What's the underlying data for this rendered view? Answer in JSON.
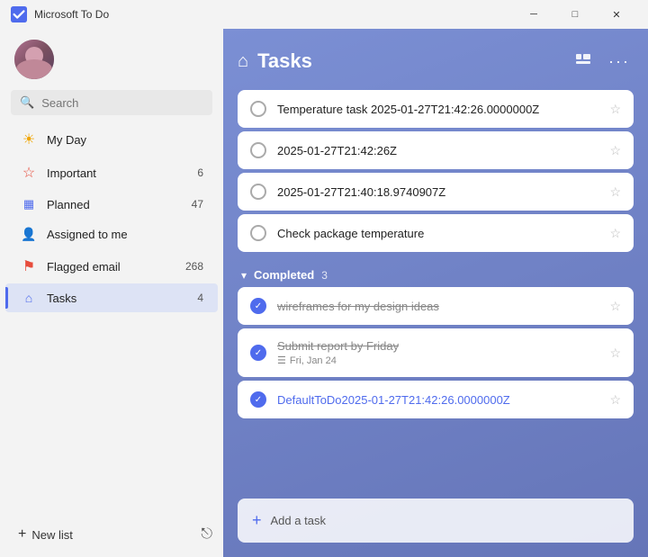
{
  "app": {
    "title": "Microsoft To Do",
    "logo_symbol": "✔"
  },
  "titlebar": {
    "minimize": "─",
    "maximize": "□",
    "close": "✕"
  },
  "sidebar": {
    "search_placeholder": "Search",
    "nav_items": [
      {
        "id": "my-day",
        "label": "My Day",
        "icon": "☀",
        "icon_color": "#f0a500",
        "count": null,
        "active": false
      },
      {
        "id": "important",
        "label": "Important",
        "icon": "☆",
        "icon_color": "#e74c3c",
        "count": "6",
        "active": false
      },
      {
        "id": "planned",
        "label": "Planned",
        "icon": "☰",
        "icon_color": "#4f6bed",
        "count": "47",
        "active": false
      },
      {
        "id": "assigned-to-me",
        "label": "Assigned to me",
        "icon": "👤",
        "icon_color": "#2ecc71",
        "count": null,
        "active": false
      },
      {
        "id": "flagged-email",
        "label": "Flagged email",
        "icon": "⚑",
        "icon_color": "#e74c3c",
        "count": "268",
        "active": false
      },
      {
        "id": "tasks",
        "label": "Tasks",
        "icon": "⌂",
        "icon_color": "#4f6bed",
        "count": "4",
        "active": true
      }
    ],
    "new_list_label": "New list",
    "new_list_icon": "+"
  },
  "main": {
    "title": "Tasks",
    "tasks": [
      {
        "id": "t1",
        "text": "Temperature task 2025-01-27T21:42:26.0000000Z",
        "completed": false,
        "starred": false
      },
      {
        "id": "t2",
        "text": "2025-01-27T21:42:26Z",
        "completed": false,
        "starred": false
      },
      {
        "id": "t3",
        "text": "2025-01-27T21:40:18.9740907Z",
        "completed": false,
        "starred": false
      },
      {
        "id": "t4",
        "text": "Check package temperature",
        "completed": false,
        "starred": false
      }
    ],
    "completed_section": {
      "label": "Completed",
      "count": "3",
      "tasks": [
        {
          "id": "c1",
          "text": "wireframes for my design ideas",
          "completed": true,
          "starred": false,
          "sub": null
        },
        {
          "id": "c2",
          "text": "Submit report by Friday",
          "completed": true,
          "starred": false,
          "sub": "Fri, Jan 24",
          "sub_icon": "☰"
        },
        {
          "id": "c3",
          "text": "DefaultToDo2025-01-27T21:42:26.0000000Z",
          "completed": true,
          "starred": false,
          "is_link": true,
          "sub": null
        }
      ]
    },
    "add_task_label": "Add a task"
  }
}
